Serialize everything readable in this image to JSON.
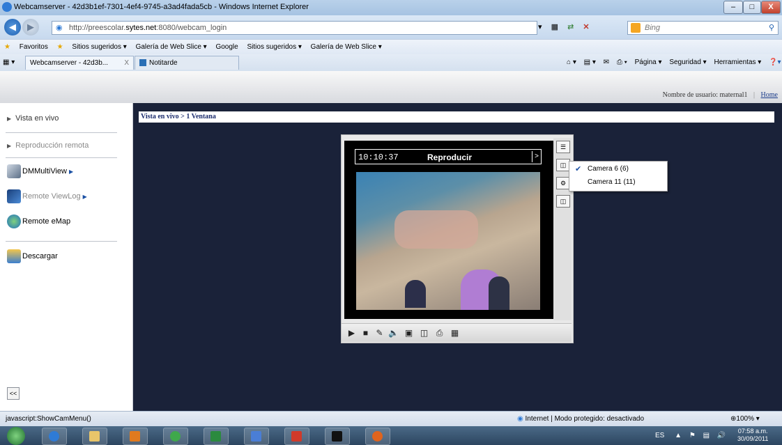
{
  "window": {
    "title": "Webcamserver - 42d3b1ef-7301-4ef4-9745-a3ad4fada5cb - Windows Internet Explorer",
    "minimize": "–",
    "maximize": "□",
    "close": "X"
  },
  "address_bar": {
    "url_prefix": "http://preescolar.",
    "url_domain": "sytes.net",
    "url_suffix": ":8080/webcam_login",
    "search_placeholder": "Bing"
  },
  "favorites": {
    "label": "Favoritos",
    "items": [
      "Sitios sugeridos ▾",
      "Galería de Web Slice ▾",
      "Google",
      "Sitios sugeridos ▾",
      "Galería de Web Slice ▾"
    ]
  },
  "tabs": [
    {
      "label": "Webcamserver - 42d3b...",
      "close": "X"
    },
    {
      "label": "Notitarde"
    }
  ],
  "command_bar": {
    "page": "Página ▾",
    "security": "Seguridad ▾",
    "tools": "Herramientas ▾"
  },
  "header": {
    "user_label": "Nombre de usuario: maternal1",
    "separator": "|",
    "home": "Home"
  },
  "sidebar": {
    "live_view": "Vista en vivo",
    "remote_playback": "Reproducción remota",
    "apps": [
      "DMMultiView",
      "Remote ViewLog",
      "Remote eMap"
    ],
    "download": "Descargar",
    "collapse": "<<"
  },
  "breadcrumb": "Vista en vivo > 1 Ventana",
  "viewer": {
    "time": "10:10:37",
    "status": "Reproducir",
    "next": ">"
  },
  "camera_menu": [
    {
      "label": "Camera 6 (6)",
      "checked": true
    },
    {
      "label": "Camera 11 (11)",
      "checked": false
    }
  ],
  "status_bar": {
    "left": "javascript:ShowCamMenu()",
    "zone": "Internet | Modo protegido: desactivado",
    "zoom": "100%"
  },
  "taskbar": {
    "language": "ES",
    "time": "07:58 a.m.",
    "date": "30/09/2011"
  }
}
